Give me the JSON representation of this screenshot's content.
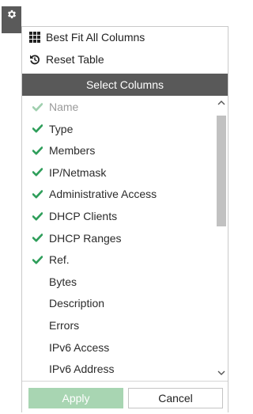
{
  "toolbar": {
    "settings_icon": "gear-icon"
  },
  "menu": {
    "best_fit_label": "Best Fit All Columns",
    "best_fit_icon": "grid-icon",
    "reset_label": "Reset Table",
    "reset_icon": "reset-icon"
  },
  "section": {
    "title": "Select Columns"
  },
  "columns": [
    {
      "label": "Name",
      "checked": true,
      "disabled": true
    },
    {
      "label": "Type",
      "checked": true,
      "disabled": false
    },
    {
      "label": "Members",
      "checked": true,
      "disabled": false
    },
    {
      "label": "IP/Netmask",
      "checked": true,
      "disabled": false
    },
    {
      "label": "Administrative Access",
      "checked": true,
      "disabled": false
    },
    {
      "label": "DHCP Clients",
      "checked": true,
      "disabled": false
    },
    {
      "label": "DHCP Ranges",
      "checked": true,
      "disabled": false
    },
    {
      "label": "Ref.",
      "checked": true,
      "disabled": false
    },
    {
      "label": "Bytes",
      "checked": false,
      "disabled": false
    },
    {
      "label": "Description",
      "checked": false,
      "disabled": false
    },
    {
      "label": "Errors",
      "checked": false,
      "disabled": false
    },
    {
      "label": "IPv6 Access",
      "checked": false,
      "disabled": false
    },
    {
      "label": "IPv6 Address",
      "checked": false,
      "disabled": false
    }
  ],
  "footer": {
    "apply_label": "Apply",
    "cancel_label": "Cancel"
  },
  "colors": {
    "check": "#2e9e5a",
    "check_disabled": "#9fcfae",
    "header_bg": "#595959",
    "apply_bg": "#a8d5b2"
  }
}
